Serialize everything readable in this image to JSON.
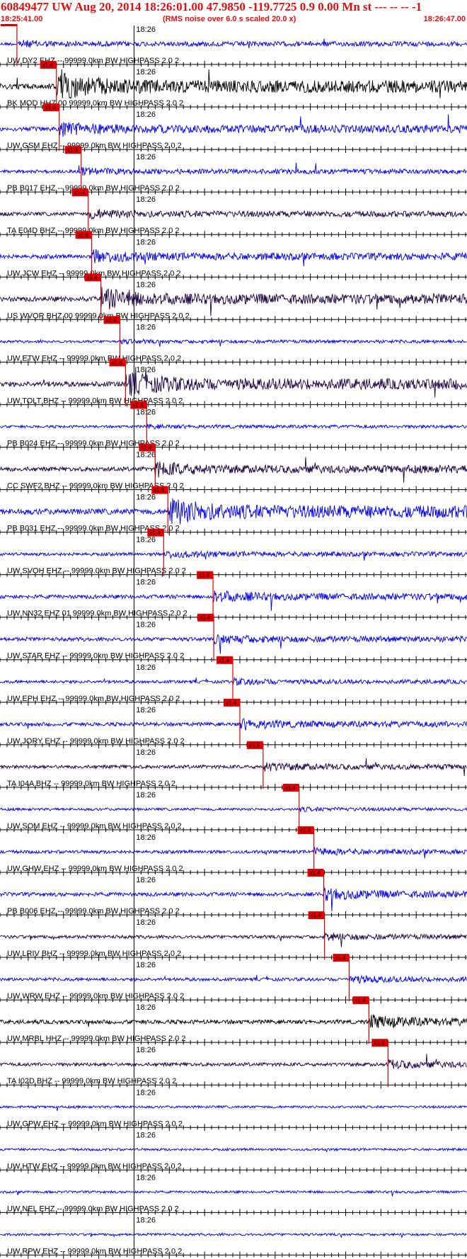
{
  "header": {
    "title": "60849477 UW Aug 20, 2014 18:26:01.00   47.9850 -119.7725  0.9 0.00 Mn st --- -- --  -1",
    "start_time": "18:25:41.00",
    "noise_note": "(RMS noise over 6.0 s scaled 20.0 x)",
    "end_time": "18:26:47.00"
  },
  "colors": {
    "header_text": "#e01010",
    "pick": "#e00000",
    "trace_blue": "#0000ee",
    "trace_dark": "#1a0040",
    "trace_black": "#000000"
  },
  "chart_data": {
    "type": "seismogram",
    "time_window": [
      "18:25:41.00",
      "18:26:47.00"
    ],
    "minute_marker": "18:26",
    "pick_label": "x1.4",
    "traces": [
      {
        "label": "UW DY2 EHZ -- 99999.0km BW  HIGHPASS  2.0  2",
        "pick_s": 2.4,
        "color": "blue",
        "amp": 0.35
      },
      {
        "label": "BK MOD HHZ 00 99999.0km BW  HIGHPASS  2.0  2",
        "pick_s": 8.0,
        "color": "black",
        "amp": 0.9
      },
      {
        "label": "UW GSM EHZ -- 99999.0km BW  HIGHPASS  2.0  2",
        "pick_s": 8.4,
        "color": "blue",
        "amp": 0.6
      },
      {
        "label": "PB B017 EHZ -- 99999.0km BW  HIGHPASS  2.0  2",
        "pick_s": 11.5,
        "color": "blue",
        "amp": 0.35
      },
      {
        "label": "TA E04D BHZ -- 99999.0km BW  HIGHPASS  2.0  2",
        "pick_s": 12.5,
        "color": "dark",
        "amp": 0.45
      },
      {
        "label": "UW JCW EHZ -- 99999.0km BW  HIGHPASS  2.0  2",
        "pick_s": 13.0,
        "color": "blue",
        "amp": 0.55
      },
      {
        "label": "US WVOR BHZ 00 99999.0km BW  HIGHPASS  2.0  2",
        "pick_s": 14.3,
        "color": "dark",
        "amp": 0.75
      },
      {
        "label": "UW ETW EHZ -- 99999.0km BW  HIGHPASS  2.0  2",
        "pick_s": 17.0,
        "color": "blue",
        "amp": 0.2
      },
      {
        "label": "UW TOLT BHZ -- 99999.0km BW  HIGHPASS  2.0  2",
        "pick_s": 17.8,
        "color": "dark",
        "amp": 0.8
      },
      {
        "label": "PB B024 EHZ -- 99999.0km BW  HIGHPASS  2.0  2",
        "pick_s": 20.8,
        "color": "blue",
        "amp": 0.2
      },
      {
        "label": "CC SWF2 BHZ -- 99999.0km BW  HIGHPASS  2.0  2",
        "pick_s": 22.0,
        "color": "dark",
        "amp": 0.6
      },
      {
        "label": "PB B031 EHZ -- 99999.0km BW  HIGHPASS  2.0  2",
        "pick_s": 23.8,
        "color": "blue",
        "amp": 0.9
      },
      {
        "label": "UW SVOH EHZ -- 99999.0km BW  HIGHPASS  2.0  2",
        "pick_s": 23.2,
        "color": "blue",
        "amp": 0.35
      },
      {
        "label": "UW NN32 EHZ 01 99999.0km BW  HIGHPASS  2.0  2",
        "pick_s": 30.2,
        "color": "blue",
        "amp": 0.5
      },
      {
        "label": "UW STAR EHZ -- 99999.0km BW  HIGHPASS  2.0  2",
        "pick_s": 30.3,
        "color": "blue",
        "amp": 0.45
      },
      {
        "label": "UW EPH EHZ -- 99999.0km BW  HIGHPASS  2.0  2",
        "pick_s": 33.0,
        "color": "blue",
        "amp": 0.3
      },
      {
        "label": "UW JORY EHZ -- 99999.0km BW  HIGHPASS  2.0  2",
        "pick_s": 34.0,
        "color": "blue",
        "amp": 0.45
      },
      {
        "label": "TA I04A BHZ -- 99999.0km BW  HIGHPASS  2.0  2",
        "pick_s": 37.3,
        "color": "dark",
        "amp": 0.4
      },
      {
        "label": "UW SOM EHZ -- 99999.0km BW  HIGHPASS  2.0  2",
        "pick_s": 42.4,
        "color": "blue",
        "amp": 0.2
      },
      {
        "label": "UW GHW EHZ -- 99999.0km BW  HIGHPASS  2.0  2",
        "pick_s": 44.5,
        "color": "blue",
        "amp": 0.35
      },
      {
        "label": "PB B006 EHZ -- 99999.0km BW  HIGHPASS  2.0  2",
        "pick_s": 45.9,
        "color": "blue",
        "amp": 0.5
      },
      {
        "label": "UW LRIV BHZ -- 99999.0km BW  HIGHPASS  2.0  2",
        "pick_s": 46.0,
        "color": "dark",
        "amp": 0.35
      },
      {
        "label": "UW WRW EHZ -- 99999.0km BW  HIGHPASS  2.0  2",
        "pick_s": 49.5,
        "color": "blue",
        "amp": 0.35
      },
      {
        "label": "UW MRBL HHZ -- 99999.0km BW  HIGHPASS  2.0  2",
        "pick_s": 52.3,
        "color": "black",
        "amp": 0.55
      },
      {
        "label": "TA I02D BHZ -- 99999.0km BW  HIGHPASS  2.0  2",
        "pick_s": 55.0,
        "color": "dark",
        "amp": 0.4
      },
      {
        "label": "UW GPW EHZ -- 99999.0km BW  HIGHPASS  2.0  2",
        "pick_s": null,
        "color": "blue",
        "amp": 0.15
      },
      {
        "label": "UW HTW EHZ -- 99999.0km BW  HIGHPASS  2.0  2",
        "pick_s": null,
        "color": "blue",
        "amp": 0.15
      },
      {
        "label": "UW NEL EHZ -- 99999.0km BW  HIGHPASS  2.0  2",
        "pick_s": null,
        "color": "blue",
        "amp": 0.15
      },
      {
        "label": "UW RPW EHZ -- 99999.0km BW  HIGHPASS  2.0  2",
        "pick_s": null,
        "color": "blue",
        "amp": 0.15
      }
    ]
  }
}
